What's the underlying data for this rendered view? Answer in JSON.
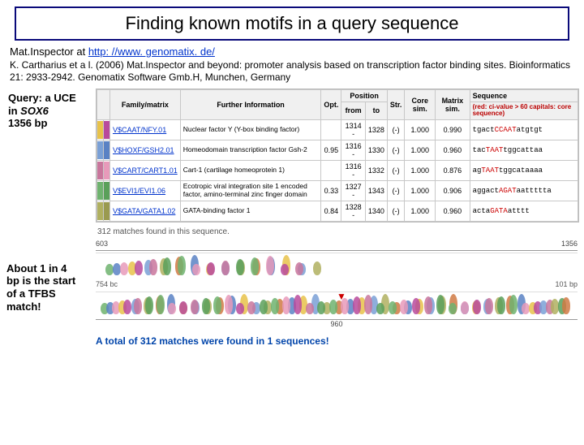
{
  "title": "Finding known motifs in a query sequence",
  "intro_prefix": "Mat.Inspector at ",
  "intro_link": "http: //www. genomatix. de/",
  "citation": "K. Cartharius et a l. (2006) Mat.Inspector and beyond: promoter analysis based on transcription factor binding sites. Bioinformatics 21: 2933-2942. Genomatix Software Gmb.H, Munchen, Germany",
  "query": {
    "l1": "Query: a UCE",
    "l2_pre": "in ",
    "l2_gene": "SOX6",
    "l3": "1356 bp"
  },
  "headers": {
    "fam": "Family/matrix",
    "info": "Further Information",
    "opt": "Opt.",
    "pos": "Position",
    "from": "from",
    "to": "to",
    "str": "Str.",
    "core": "Core sim.",
    "matrix": "Matrix sim.",
    "seq": "Sequence",
    "seq_sub": "(red: ci-value > 60 capitals: core sequence)"
  },
  "rows": [
    {
      "bars": [
        "#e8c24a",
        "#b84a9c"
      ],
      "link": "V$CAAT/NFY.01",
      "info": "Nuclear factor Y (Y-box binding factor)",
      "opt": "",
      "from": "1314 -",
      "to": "1328",
      "str": "(-)",
      "core": "1.000",
      "matrix": "0.990",
      "seq_pre": "tgact",
      "seq_hi": "CCAAT",
      "seq_post": "atgtgt"
    },
    {
      "bars": [
        "#7aa0d6",
        "#5a82c4"
      ],
      "link": "V$HOXF/GSH2.01",
      "info": "Homeodomain transcription factor Gsh-2",
      "opt": "0.95",
      "from": "1316 -",
      "to": "1330",
      "str": "(-)",
      "core": "1.000",
      "matrix": "0.960",
      "seq_pre": "tac",
      "seq_hi": "TAAT",
      "seq_post": "tggcattaa"
    },
    {
      "bars": [
        "#c9769c",
        "#e79aba"
      ],
      "link": "V$CART/CART1.01",
      "info": "Cart-1 (cartilage homeoprotein 1)",
      "opt": "",
      "from": "1316 -",
      "to": "1332",
      "str": "(-)",
      "core": "1.000",
      "matrix": "0.876",
      "seq_pre": "ag",
      "seq_hi": "TAAT",
      "seq_post": "tggcataaaa"
    },
    {
      "bars": [
        "#6fb36f",
        "#5aa05a"
      ],
      "link": "V$EVI1/EVI1.06",
      "info": "Ecotropic viral integration site 1 encoded factor, amino-terminal zinc finger domain",
      "opt": "0.33",
      "from": "1327 -",
      "to": "1343",
      "str": "(-)",
      "core": "1.000",
      "matrix": "0.906",
      "seq_pre": "aggact",
      "seq_hi": "AGAT",
      "seq_post": "aattttta"
    },
    {
      "bars": [
        "#b0b060",
        "#9a9a50"
      ],
      "link": "V$GATA/GATA1.02",
      "info": "GATA-binding factor 1",
      "opt": "0.84",
      "from": "1328 -",
      "to": "1340",
      "str": "(-)",
      "core": "1.000",
      "matrix": "0.960",
      "seq_pre": "acta",
      "seq_hi": "GATA",
      "seq_post": "atttt"
    }
  ],
  "matches_line": "312 matches found in this sequence.",
  "axis_top": {
    "left": "603",
    "right": "1356"
  },
  "left_label": "754 bc",
  "right_label": "101 bp",
  "axis_mid": "960",
  "about": {
    "l1": "About 1 in 4",
    "l2": "bp is the start",
    "l3": "of a TFBS",
    "l4": "match!"
  },
  "total": "A total of 312 matches were found in 1 sequences!",
  "blob_colors": [
    "#6fb36f",
    "#5a82c4",
    "#e79aba",
    "#e8c24a",
    "#b84a9c",
    "#7aa0d6",
    "#c9769c",
    "#b0b060",
    "#5aa05a",
    "#d07a44"
  ]
}
